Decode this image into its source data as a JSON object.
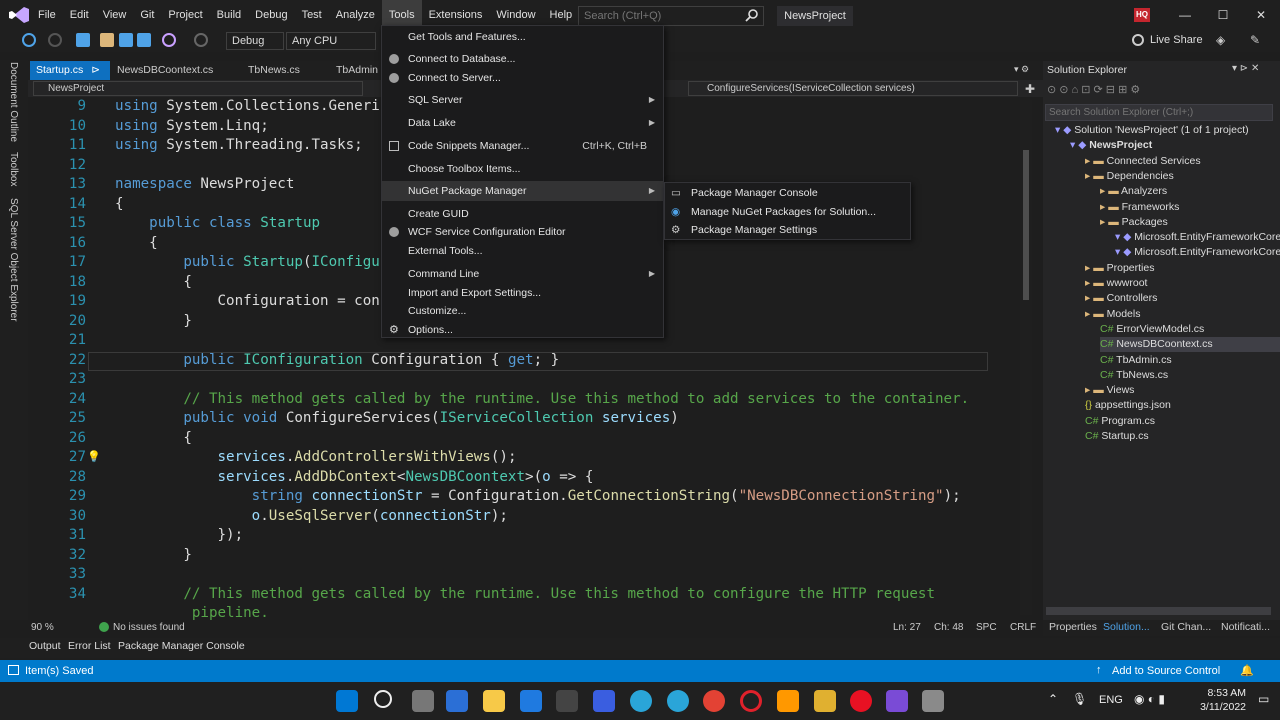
{
  "menubar": {
    "items": [
      "File",
      "Edit",
      "View",
      "Git",
      "Project",
      "Build",
      "Debug",
      "Test",
      "Analyze",
      "Tools",
      "Extensions",
      "Window",
      "Help"
    ]
  },
  "search": {
    "placeholder": "Search (Ctrl+Q)"
  },
  "project_title": "NewsProject",
  "user_initials": "HQ",
  "toolbar": {
    "config": "Debug",
    "platform": "Any CPU",
    "live_share": "Live Share"
  },
  "left_strip": [
    "Document Outline",
    "Toolbox",
    "SQL Server Object Explorer"
  ],
  "doc_tabs": [
    "Startup.cs",
    "NewsDBCoontext.cs",
    "TbNews.cs",
    "TbAdmin"
  ],
  "navbar": {
    "left": "NewsProject",
    "right": "ConfigureServices(IServiceCollection services)"
  },
  "code": [
    {
      "n": "9",
      "t": "using System.Collections.Generi"
    },
    {
      "n": "10",
      "t": "using System.Linq;"
    },
    {
      "n": "11",
      "t": "using System.Threading.Tasks;"
    },
    {
      "n": "12",
      "t": ""
    },
    {
      "n": "13",
      "t": "namespace NewsProject"
    },
    {
      "n": "14",
      "t": "{"
    },
    {
      "n": "15",
      "t": "    public class Startup"
    },
    {
      "n": "16",
      "t": "    {"
    },
    {
      "n": "17",
      "t": "        public Startup(IConfigu"
    },
    {
      "n": "18",
      "t": "        {"
    },
    {
      "n": "19",
      "t": "            Configuration = con"
    },
    {
      "n": "20",
      "t": "        }"
    },
    {
      "n": "21",
      "t": ""
    },
    {
      "n": "22",
      "t": "        public IConfiguration Configuration { get; }"
    },
    {
      "n": "23",
      "t": ""
    },
    {
      "n": "24",
      "t": "        // This method gets called by the runtime. Use this method to add services to the container."
    },
    {
      "n": "25",
      "t": "        public void ConfigureServices(IServiceCollection services)"
    },
    {
      "n": "26",
      "t": "        {"
    },
    {
      "n": "27",
      "t": "            services.AddControllersWithViews();"
    },
    {
      "n": "28",
      "t": "            services.AddDbContext<NewsDBCoontext>(o => {"
    },
    {
      "n": "29",
      "t": "                string connectionStr = Configuration.GetConnectionString(\"NewsDBConnectionString\");"
    },
    {
      "n": "30",
      "t": "                o.UseSqlServer(connectionStr);"
    },
    {
      "n": "31",
      "t": "            });"
    },
    {
      "n": "32",
      "t": "        }"
    },
    {
      "n": "33",
      "t": ""
    },
    {
      "n": "34",
      "t": "        // This method gets called by the runtime. Use this method to configure the HTTP request"
    },
    {
      "n": "",
      "t": "         pipeline."
    }
  ],
  "editor_status": {
    "zoom": "90 %",
    "issues": "No issues found",
    "ln": "Ln: 27",
    "ch": "Ch: 48",
    "spc": "SPC",
    "crlf": "CRLF"
  },
  "tools_menu": [
    {
      "label": "Get Tools and Features...",
      "shortcut": "",
      "arrow": false
    },
    {
      "label": "Connect to Database...",
      "shortcut": "",
      "arrow": false
    },
    {
      "label": "Connect to Server...",
      "shortcut": "",
      "arrow": false
    },
    {
      "label": "SQL Server",
      "shortcut": "",
      "arrow": true
    },
    {
      "label": "Data Lake",
      "shortcut": "",
      "arrow": true
    },
    {
      "label": "Code Snippets Manager...",
      "shortcut": "Ctrl+K, Ctrl+B",
      "arrow": false
    },
    {
      "label": "Choose Toolbox Items...",
      "shortcut": "",
      "arrow": false
    },
    {
      "label": "NuGet Package Manager",
      "shortcut": "",
      "arrow": true
    },
    {
      "label": "Create GUID",
      "shortcut": "",
      "arrow": false
    },
    {
      "label": "WCF Service Configuration Editor",
      "shortcut": "",
      "arrow": false
    },
    {
      "label": "External Tools...",
      "shortcut": "",
      "arrow": false
    },
    {
      "label": "Command Line",
      "shortcut": "",
      "arrow": true
    },
    {
      "label": "Import and Export Settings...",
      "shortcut": "",
      "arrow": false
    },
    {
      "label": "Customize...",
      "shortcut": "",
      "arrow": false
    },
    {
      "label": "Options...",
      "shortcut": "",
      "arrow": false
    }
  ],
  "nuget_submenu": [
    "Package Manager Console",
    "Manage NuGet Packages for Solution...",
    "Package Manager Settings"
  ],
  "solution_explorer": {
    "title": "Solution Explorer",
    "search_placeholder": "Search Solution Explorer (Ctrl+;)",
    "items": [
      {
        "label": "Solution 'NewsProject' (1 of 1 project)",
        "level": 0
      },
      {
        "label": "NewsProject",
        "level": 1
      },
      {
        "label": "Connected Services",
        "level": 2
      },
      {
        "label": "Dependencies",
        "level": 2
      },
      {
        "label": "Analyzers",
        "level": 3
      },
      {
        "label": "Frameworks",
        "level": 3
      },
      {
        "label": "Packages",
        "level": 3
      },
      {
        "label": "Microsoft.EntityFrameworkCore.S",
        "level": 4
      },
      {
        "label": "Microsoft.EntityFrameworkCore.T",
        "level": 4
      },
      {
        "label": "Properties",
        "level": 2
      },
      {
        "label": "wwwroot",
        "level": 2
      },
      {
        "label": "Controllers",
        "level": 2
      },
      {
        "label": "Models",
        "level": 2
      },
      {
        "label": "ErrorViewModel.cs",
        "level": 3
      },
      {
        "label": "NewsDBCoontext.cs",
        "level": 3
      },
      {
        "label": "TbAdmin.cs",
        "level": 3
      },
      {
        "label": "TbNews.cs",
        "level": 3
      },
      {
        "label": "Views",
        "level": 2
      },
      {
        "label": "appsettings.json",
        "level": 2
      },
      {
        "label": "Program.cs",
        "level": 2
      },
      {
        "label": "Startup.cs",
        "level": 2
      }
    ],
    "bottom_tabs": [
      "Properties",
      "Solution...",
      "Git Chan...",
      "Notificati..."
    ]
  },
  "output_tabs": [
    "Output",
    "Error List",
    "Package Manager Console"
  ],
  "statusbar": {
    "left": "Item(s) Saved",
    "right": "Add to Source Control"
  },
  "taskbar": {
    "lang": "ENG",
    "time": "8:53 AM",
    "date": "3/11/2022"
  },
  "colors": {
    "accent": "#007acc",
    "tab_active": "#0e70c0"
  }
}
